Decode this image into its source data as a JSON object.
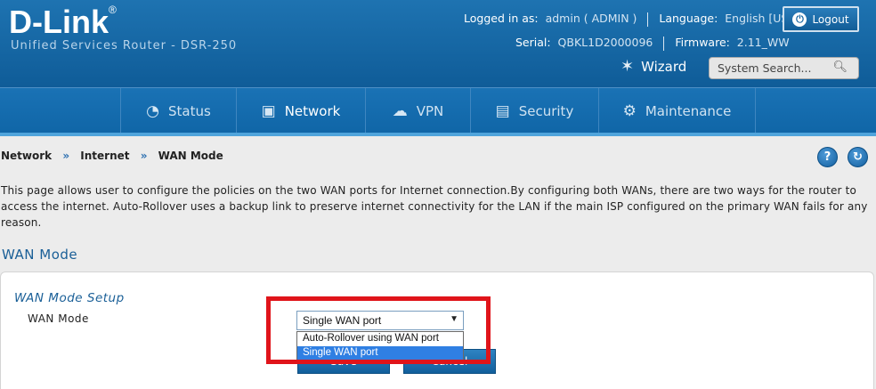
{
  "header": {
    "brand": "D-Link",
    "reg_mark": "®",
    "subtitle": "Unified Services Router - DSR-250",
    "logged_in_label": "Logged in as:",
    "user": "admin ( ADMIN )",
    "language_label": "Language:",
    "language": "English [US]",
    "serial_label": "Serial:",
    "serial": "QBKL1D2000096",
    "firmware_label": "Firmware:",
    "firmware": "2.11_WW",
    "logout_label": "Logout",
    "wizard_label": "Wizard",
    "search_placeholder": "System Search...",
    "icons": [
      "power-icon",
      "wand-icon",
      "search-icon"
    ]
  },
  "nav": {
    "items": [
      {
        "label": "Status",
        "icon": "gauge-icon"
      },
      {
        "label": "Network",
        "icon": "monitor-icon"
      },
      {
        "label": "VPN",
        "icon": "cloud-lock-icon"
      },
      {
        "label": "Security",
        "icon": "lock-icon"
      },
      {
        "label": "Maintenance",
        "icon": "gears-icon"
      }
    ],
    "active": "Network"
  },
  "breadcrumb": {
    "items": [
      "Network",
      "Internet",
      "WAN Mode"
    ],
    "separator": "»"
  },
  "toolbar": {
    "help": "?",
    "refresh": "↻"
  },
  "description": "This page allows user to configure the policies on the two WAN ports for Internet connection.By configuring both WANs, there are two ways for the router to access the internet. Auto-Rollover uses a backup link to preserve internet connectivity for the LAN if the main ISP configured on the primary WAN fails for any reason.",
  "section_title": "WAN Mode",
  "setup": {
    "title": "WAN Mode Setup",
    "field_label": "WAN Mode",
    "selected": "Single WAN port",
    "options": [
      "Auto-Rollover using WAN port",
      "Single WAN port"
    ],
    "save_label": "Save",
    "cancel_label": "Cancel"
  },
  "colors": {
    "header": "#1a6aa8",
    "accent": "#1a5f97",
    "highlight": "#e0141a",
    "selected_option": "#2f7fe3"
  }
}
